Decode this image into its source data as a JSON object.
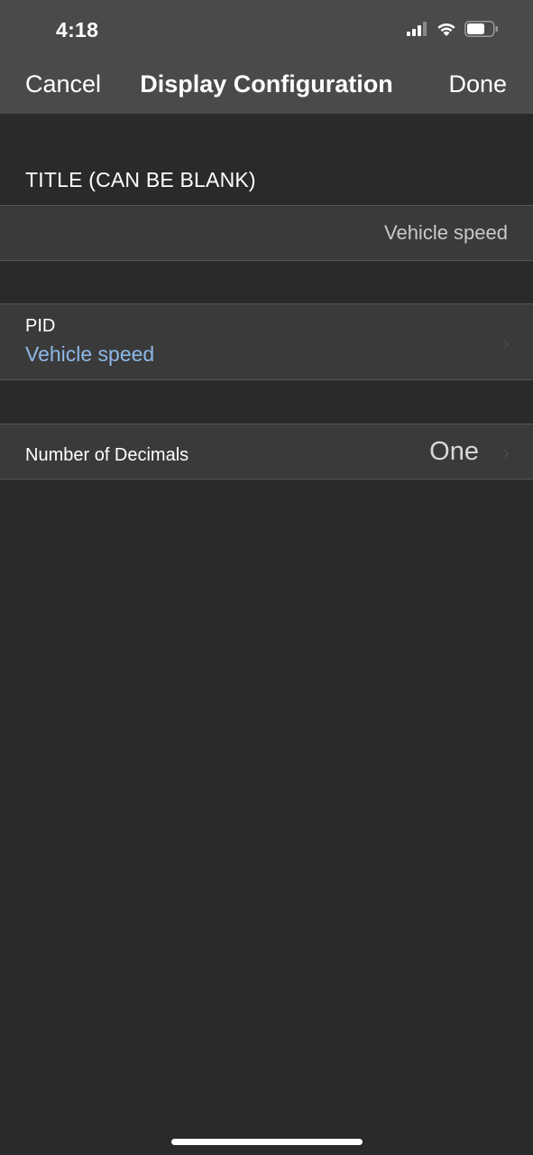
{
  "status_bar": {
    "time": "4:18",
    "icons": [
      "cellular-signal-icon",
      "wifi-icon",
      "battery-icon"
    ]
  },
  "nav": {
    "cancel_label": "Cancel",
    "title": "Display Configuration",
    "done_label": "Done"
  },
  "title_section": {
    "header": "TITLE (CAN BE BLANK)",
    "value": "Vehicle speed"
  },
  "pid": {
    "label": "PID",
    "value": "Vehicle speed"
  },
  "decimals": {
    "label": "Number of Decimals",
    "value": "One"
  },
  "colors": {
    "background": "#2a2a2a",
    "bar": "#4a4a4a",
    "cell": "#3a3a3a",
    "link_blue": "#8db8e8"
  }
}
